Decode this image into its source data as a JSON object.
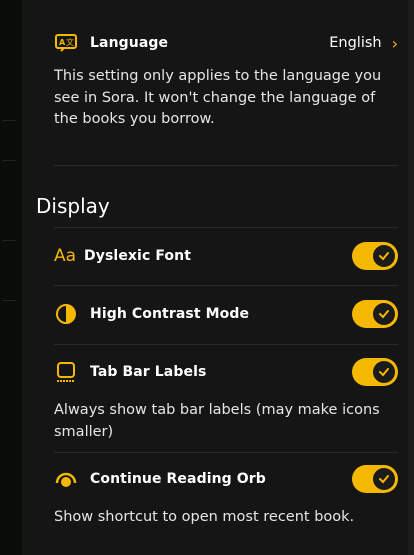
{
  "language": {
    "label": "Language",
    "value": "English",
    "description": "This setting only applies to the language you see in Sora. It won't change the language of the books you borrow."
  },
  "display": {
    "section_title": "Display",
    "items": [
      {
        "label": "Dyslexic Font",
        "enabled": true,
        "icon_text": "Aa"
      },
      {
        "label": "High Contrast Mode",
        "enabled": true
      },
      {
        "label": "Tab Bar Labels",
        "enabled": true,
        "description": "Always show tab bar labels (may make icons smaller)"
      },
      {
        "label": "Continue Reading Orb",
        "enabled": true,
        "description": "Show shortcut to open most recent book."
      }
    ]
  },
  "colors": {
    "accent": "#f5b800",
    "background": "#151515",
    "divider": "#2a2a2a"
  },
  "icons": {
    "language": "translate-icon",
    "chevron": "chevron-right-icon",
    "dyslexic": "font-aa-icon",
    "contrast": "contrast-icon",
    "tabbar": "tab-bar-icon",
    "orb": "orb-icon",
    "check": "check-icon"
  }
}
